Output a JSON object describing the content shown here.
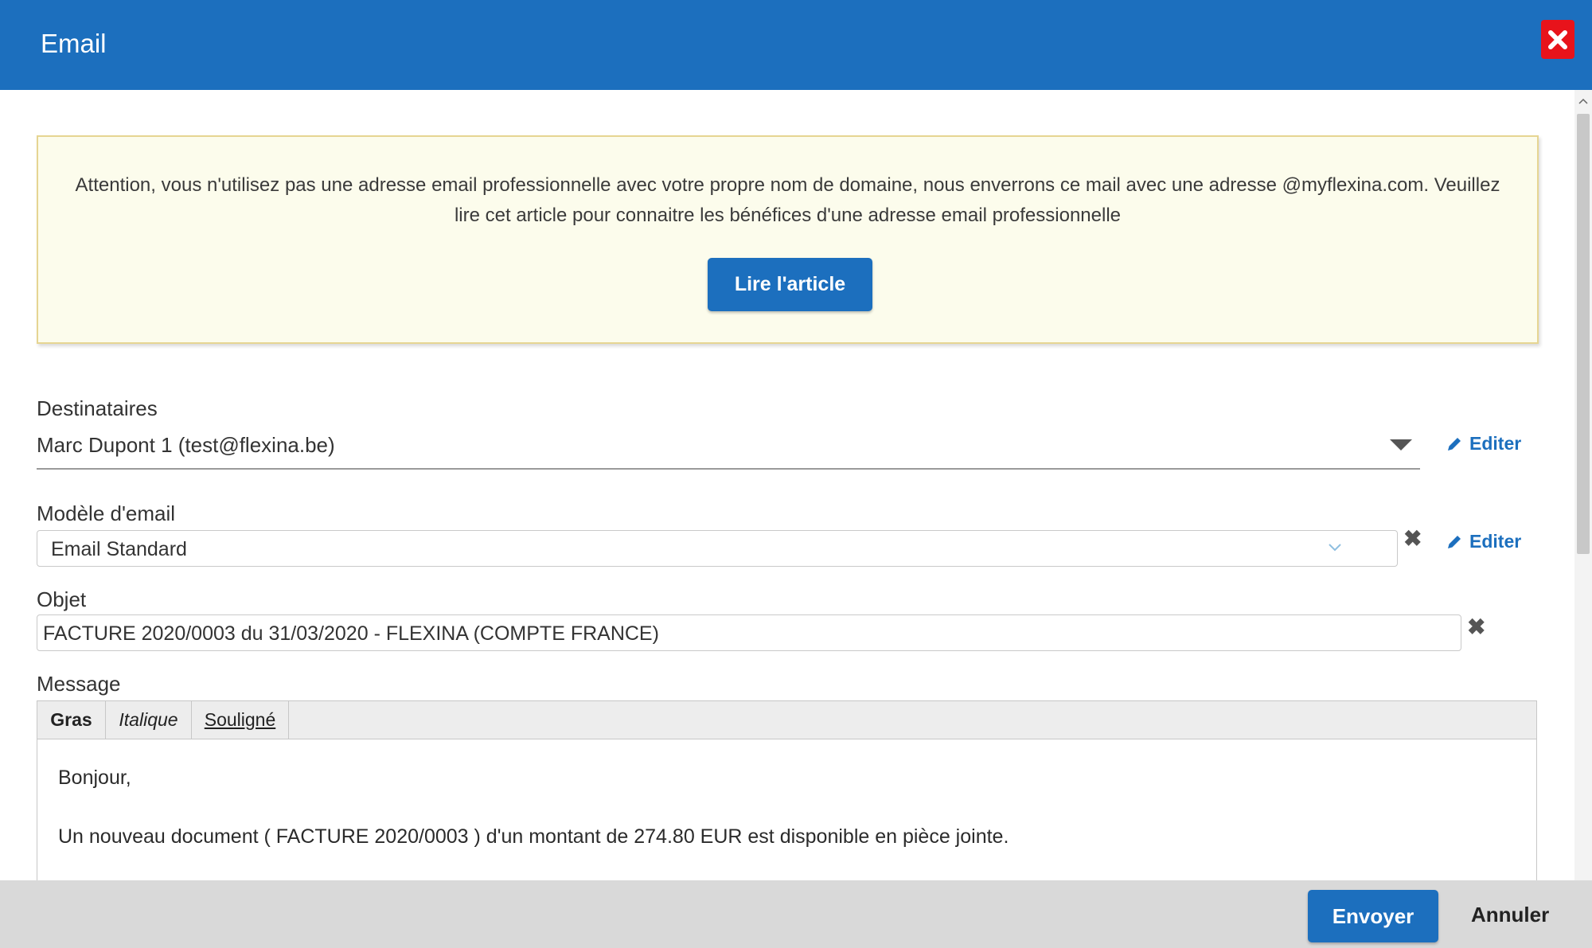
{
  "dialog": {
    "title": "Email",
    "close_icon": "close-icon",
    "accent_color": "#1c6fbe",
    "close_color": "#e8131b"
  },
  "alert": {
    "text": "Attention, vous n'utilisez pas une adresse email professionnelle avec votre propre nom de domaine, nous enverrons ce mail avec une adresse @myflexina.com. Veuillez lire cet article pour connaitre les bénéfices d'une adresse email professionnelle",
    "button_label": "Lire l'article"
  },
  "recipients": {
    "label": "Destinataires",
    "value": "Marc Dupont 1 (test@flexina.be)",
    "edit_label": "Editer"
  },
  "template": {
    "label": "Modèle d'email",
    "value": "Email Standard",
    "edit_label": "Editer"
  },
  "subject": {
    "label": "Objet",
    "value": "FACTURE 2020/0003 du 31/03/2020 - FLEXINA (COMPTE FRANCE)"
  },
  "message": {
    "label": "Message",
    "toolbar": {
      "bold": "Gras",
      "italic": "Italique",
      "underline": "Souligné"
    },
    "body": [
      "Bonjour,",
      "Un nouveau document ( FACTURE 2020/0003 ) d'un montant de 274.80 EUR est disponible en pièce jointe."
    ]
  },
  "footer": {
    "send_label": "Envoyer",
    "cancel_label": "Annuler"
  }
}
